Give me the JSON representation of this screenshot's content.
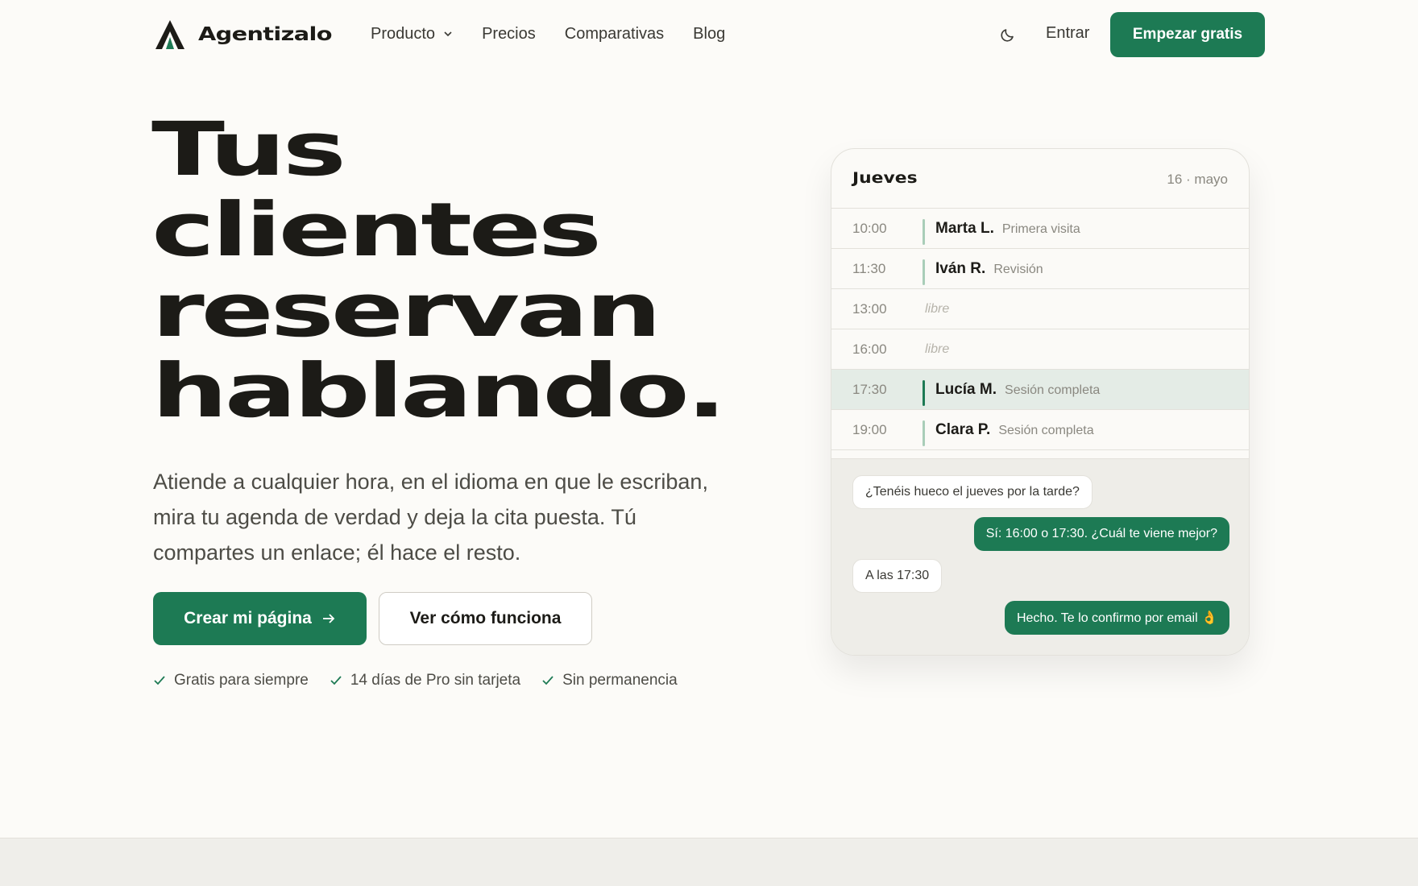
{
  "brand": {
    "name": "Agentizalo",
    "accent": "#1d7a54"
  },
  "nav": {
    "links": [
      "Producto",
      "Precios",
      "Comparativas",
      "Blog"
    ],
    "login": "Entrar",
    "cta": "Empezar gratis",
    "theme_icon": "moon-icon"
  },
  "hero": {
    "title_lines": [
      "Tus",
      "clientes",
      "reservan",
      "hablando."
    ],
    "subtitle_lines": [
      "Atiende a cualquier hora, en el idioma en que le escriban,",
      "mira tu agenda de verdad y deja la cita puesta. Tú",
      "compartes un enlace; él hace el resto."
    ],
    "primary_cta": "Crear mi página",
    "secondary_cta": "Ver cómo funciona",
    "checks": [
      "Gratis para siempre",
      "14 días de Pro sin tarjeta",
      "Sin permanencia"
    ]
  },
  "agenda": {
    "day": "Jueves",
    "date": "16 · mayo",
    "slots": [
      {
        "time": "10:00",
        "name": "Marta L.",
        "desc": "Primera visita",
        "free": false,
        "highlight": false
      },
      {
        "time": "11:30",
        "name": "Iván R.",
        "desc": "Revisión",
        "free": false,
        "highlight": false
      },
      {
        "time": "13:00",
        "name": "",
        "desc": "libre",
        "free": true,
        "highlight": false
      },
      {
        "time": "16:00",
        "name": "",
        "desc": "libre",
        "free": true,
        "highlight": false
      },
      {
        "time": "17:30",
        "name": "Lucía M.",
        "desc": "Sesión completa",
        "free": false,
        "highlight": true
      },
      {
        "time": "19:00",
        "name": "Clara P.",
        "desc": "Sesión completa",
        "free": false,
        "highlight": false
      }
    ]
  },
  "chat": {
    "messages": [
      {
        "from": "client",
        "text": "¿Tenéis hueco el jueves por la tarde?"
      },
      {
        "from": "agent",
        "text": "Sí: 16:00 o 17:30. ¿Cuál te viene mejor?"
      },
      {
        "from": "client",
        "text": "A las 17:30"
      },
      {
        "from": "agent",
        "text": "Hecho. Te lo confirmo por email 👌"
      }
    ]
  }
}
